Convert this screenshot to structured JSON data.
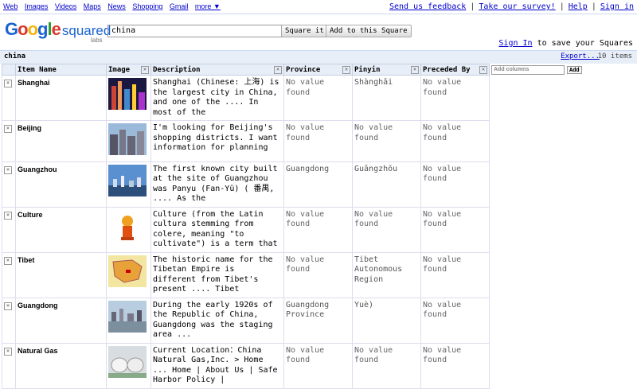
{
  "topnav": [
    "Web",
    "Images",
    "Videos",
    "Maps",
    "News",
    "Shopping",
    "Gmail",
    "more ▼"
  ],
  "toplinks": [
    "Send us feedback",
    "Take our survey!",
    "Help",
    "Sign in"
  ],
  "logo": {
    "google": "Google",
    "squared": "squared",
    "labs": "labs"
  },
  "search": {
    "value": "china",
    "square_btn": "Square it",
    "add_btn": "Add to this Square"
  },
  "signin": {
    "link": "Sign In",
    "rest": " to save your Squares"
  },
  "bar": {
    "query": "china",
    "export": "Export...",
    "count": "10 items"
  },
  "columns": [
    "Item Name",
    "Image",
    "Description",
    "Province",
    "Pinyin",
    "Preceded By"
  ],
  "add_columns": {
    "placeholder": "Add columns",
    "button": "Add"
  },
  "rows": [
    {
      "name": "Shanghai",
      "img": "city-night",
      "desc": "Shanghai (Chinese: 上海) is the largest city in China, and one of the .... In most of the",
      "province": "No value found",
      "pinyin": "Shànghǎi",
      "preceded": "No value found"
    },
    {
      "name": "Beijing",
      "img": "city-day",
      "desc": "I'm looking for Beijing's shopping districts. I want information for planning",
      "province": "No value found",
      "pinyin": "No value found",
      "preceded": "No value found"
    },
    {
      "name": "Guangzhou",
      "img": "skyline",
      "desc": "The first known city built at the site of Guangzhou was Panyu (Fan-Yü) ( 番禺, .... As the",
      "province": "Guangdong",
      "pinyin": "Guǎngzhōu",
      "preceded": "No value found"
    },
    {
      "name": "Culture",
      "img": "figure",
      "desc": "Culture (from the Latin cultura stemming from colere, meaning \"to cultivate\") is a term that",
      "province": "No value found",
      "pinyin": "No value found",
      "preceded": "No value found"
    },
    {
      "name": "Tibet",
      "img": "map",
      "desc": "The historic name for the Tibetan Empire is different from Tibet's present .... Tibet",
      "province": "No value found",
      "pinyin": "Tibet Autonomous Region",
      "preceded": "No value found"
    },
    {
      "name": "Guangdong",
      "img": "harbor",
      "desc": "During the early 1920s of the Republic of China, Guangdong was the staging area ...",
      "province": "Guangdong Province",
      "pinyin": "Yuè)",
      "preceded": "No value found"
    },
    {
      "name": "Natural Gas",
      "img": "tanks",
      "desc": "Current Location：China Natural Gas,Inc. > Home ... Home | About Us | Safe Harbor Policy |",
      "province": "No value found",
      "pinyin": "No value found",
      "preceded": "No value found"
    }
  ]
}
